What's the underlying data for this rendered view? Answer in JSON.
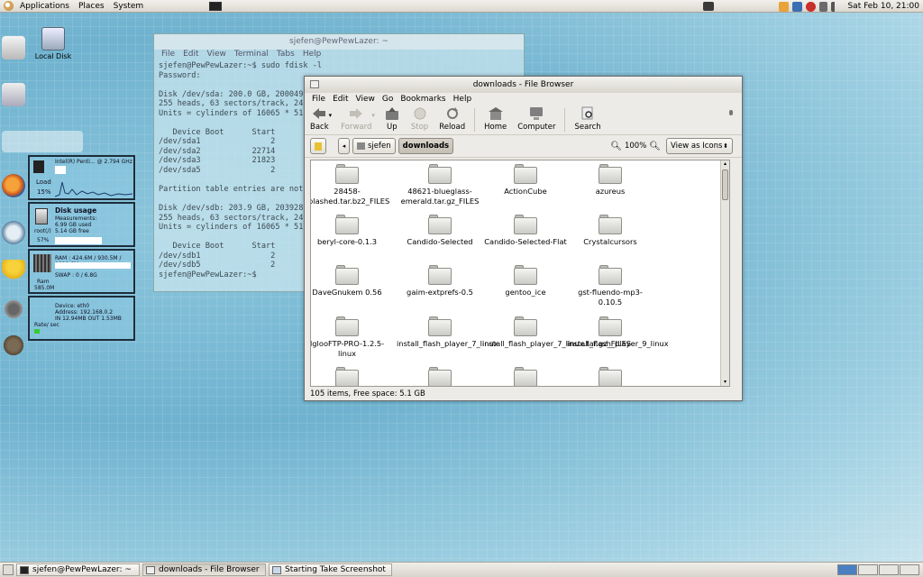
{
  "top_panel": {
    "menus": [
      "Applications",
      "Places",
      "System"
    ],
    "clock": "Sat Feb 10, 21:00"
  },
  "desktop": {
    "local_disk_label": "Local Disk"
  },
  "conky": {
    "cpu": {
      "title": "Intel(R) Penti... @ 2.794 GHz",
      "load_label": "Load",
      "load_value": "15%"
    },
    "disk": {
      "title": "Disk usage",
      "sub": "Measurements:",
      "used": "6.99 GB used",
      "free": "5.14 GB free",
      "mount": "root(/)",
      "pct": "57%"
    },
    "ram": {
      "ram_line": "RAM : 424.6M / 930.5M / 1009.6M",
      "swap_line": "SWAP : 0 / 6.8G",
      "label": "Ram",
      "value": "585.0M"
    },
    "net": {
      "device": "Device: eth0",
      "address": "Address: 192.168.0.2",
      "traffic": "IN 12.94MB    OUT 1.53MB",
      "rate": "Rate/ sec"
    }
  },
  "terminal": {
    "title": "sjefen@PewPewLazer: ~",
    "menu": [
      "File",
      "Edit",
      "View",
      "Terminal",
      "Tabs",
      "Help"
    ],
    "lines": [
      "sjefen@PewPewLazer:~$ sudo fdisk -l",
      "Password:",
      "",
      "Disk /dev/sda: 200.0 GB, 20004964",
      "255 heads, 63 sectors/track, 2432",
      "Units = cylinders of 16065 * 512",
      "",
      "   Device Boot      Start",
      "/dev/sda1               2",
      "/dev/sda2           22714",
      "/dev/sda3           21823",
      "/dev/sda5               2",
      "",
      "Partition table entries are not i",
      "",
      "Disk /dev/sdb: 203.9 GB, 20392816",
      "255 heads, 63 sectors/track, 2479",
      "Units = cylinders of 16065 * 512",
      "",
      "   Device Boot      Start",
      "/dev/sdb1               2",
      "/dev/sdb5               2",
      "sjefen@PewPewLazer:~$ "
    ]
  },
  "file_browser": {
    "title": "downloads - File Browser",
    "menu": [
      "File",
      "Edit",
      "View",
      "Go",
      "Bookmarks",
      "Help"
    ],
    "toolbar": {
      "back": "Back",
      "forward": "Forward",
      "up": "Up",
      "stop": "Stop",
      "reload": "Reload",
      "home": "Home",
      "computer": "Computer",
      "search": "Search"
    },
    "path": [
      "sjefen",
      "downloads"
    ],
    "zoom": "100%",
    "view_mode": "View as Icons",
    "items": [
      "28458-splashed.tar.bz2_FILES",
      "48621-blueglass-emerald.tar.gz_FILES",
      "ActionCube",
      "azureus",
      "beryl-core-0.1.3",
      "Candido-Selected",
      "Candido-Selected-Flat",
      "Crystalcursors",
      "DaveGnukem 0.56",
      "gaim-extprefs-0.5",
      "gentoo_ice",
      "gst-fluendo-mp3-0.10.5",
      "IglooFTP-PRO-1.2.5-linux",
      "install_flash_player_7_linux",
      "install_flash_player_7_linux.tar.gz_FILES",
      "install_flash_player_9_linux",
      "",
      "",
      "",
      ""
    ],
    "status": "105 items, Free space: 5.1 GB"
  },
  "taskbar": {
    "tasks": [
      "sjefen@PewPewLazer: ~",
      "downloads - File Browser",
      "Starting Take Screenshot"
    ]
  }
}
